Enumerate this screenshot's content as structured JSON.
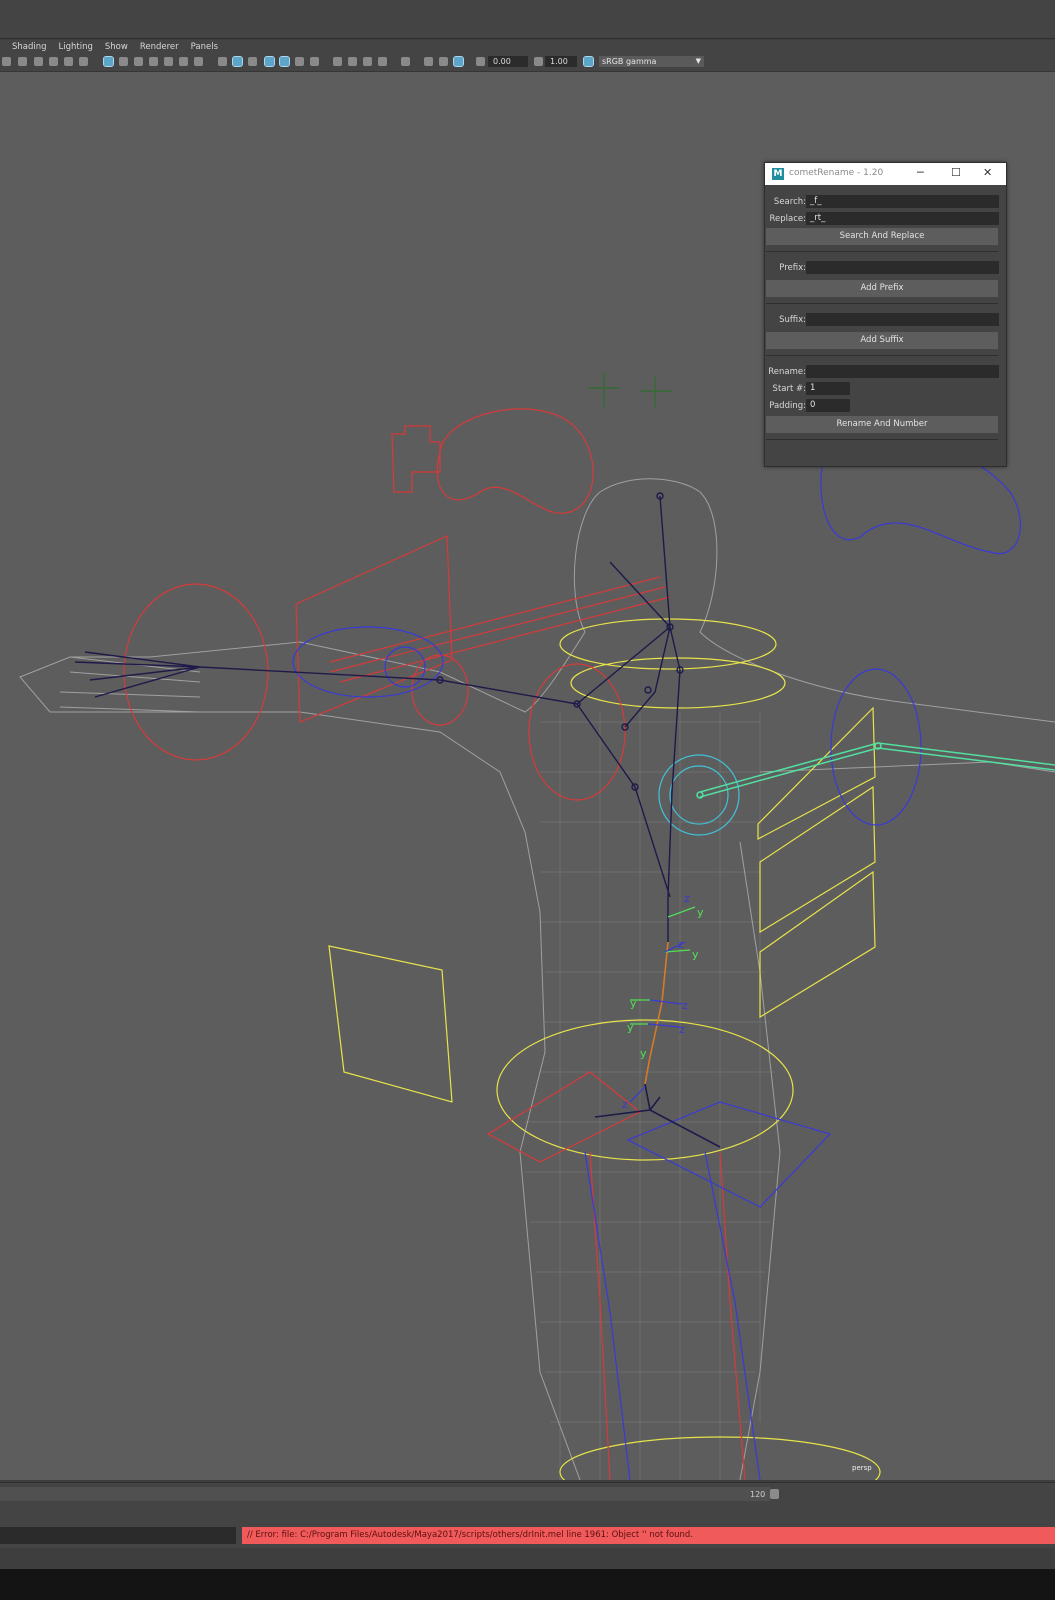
{
  "menu": [
    "Shading",
    "Lighting",
    "Show",
    "Renderer",
    "Panels"
  ],
  "toolbar": {
    "exposure_value": "0.00",
    "gamma_value": "1.00",
    "color_space": "sRGB gamma"
  },
  "viewport": {
    "camera_label": "persp",
    "axis_labels": [
      "z",
      "y",
      "z",
      "y",
      "y",
      "z",
      "y",
      "z",
      "y",
      "z"
    ]
  },
  "rename_window": {
    "title": "cometRename - 1.20",
    "search_label": "Search:",
    "search_value": "_f_",
    "replace_label": "Replace:",
    "replace_value": "_rt_",
    "search_replace_button": "Search And Replace",
    "prefix_label": "Prefix:",
    "prefix_value": "",
    "add_prefix_button": "Add Prefix",
    "suffix_label": "Suffix:",
    "suffix_value": "",
    "add_suffix_button": "Add Suffix",
    "rename_label": "Rename:",
    "rename_value": "",
    "start_label": "Start #:",
    "start_value": "1",
    "padding_label": "Padding:",
    "padding_value": "0",
    "rename_number_button": "Rename And Number"
  },
  "timeline": {
    "end_frame": "120"
  },
  "command_line": {
    "error_text": "// Error: file: C:/Program Files/Autodesk/Maya2017/scripts/others/drInit.mel line 1961: Object '' not found."
  },
  "colors": {
    "viewport_bg": "#5d5d5d",
    "error_bg": "#f15a5a",
    "active_icon": "#5ea6c9"
  }
}
